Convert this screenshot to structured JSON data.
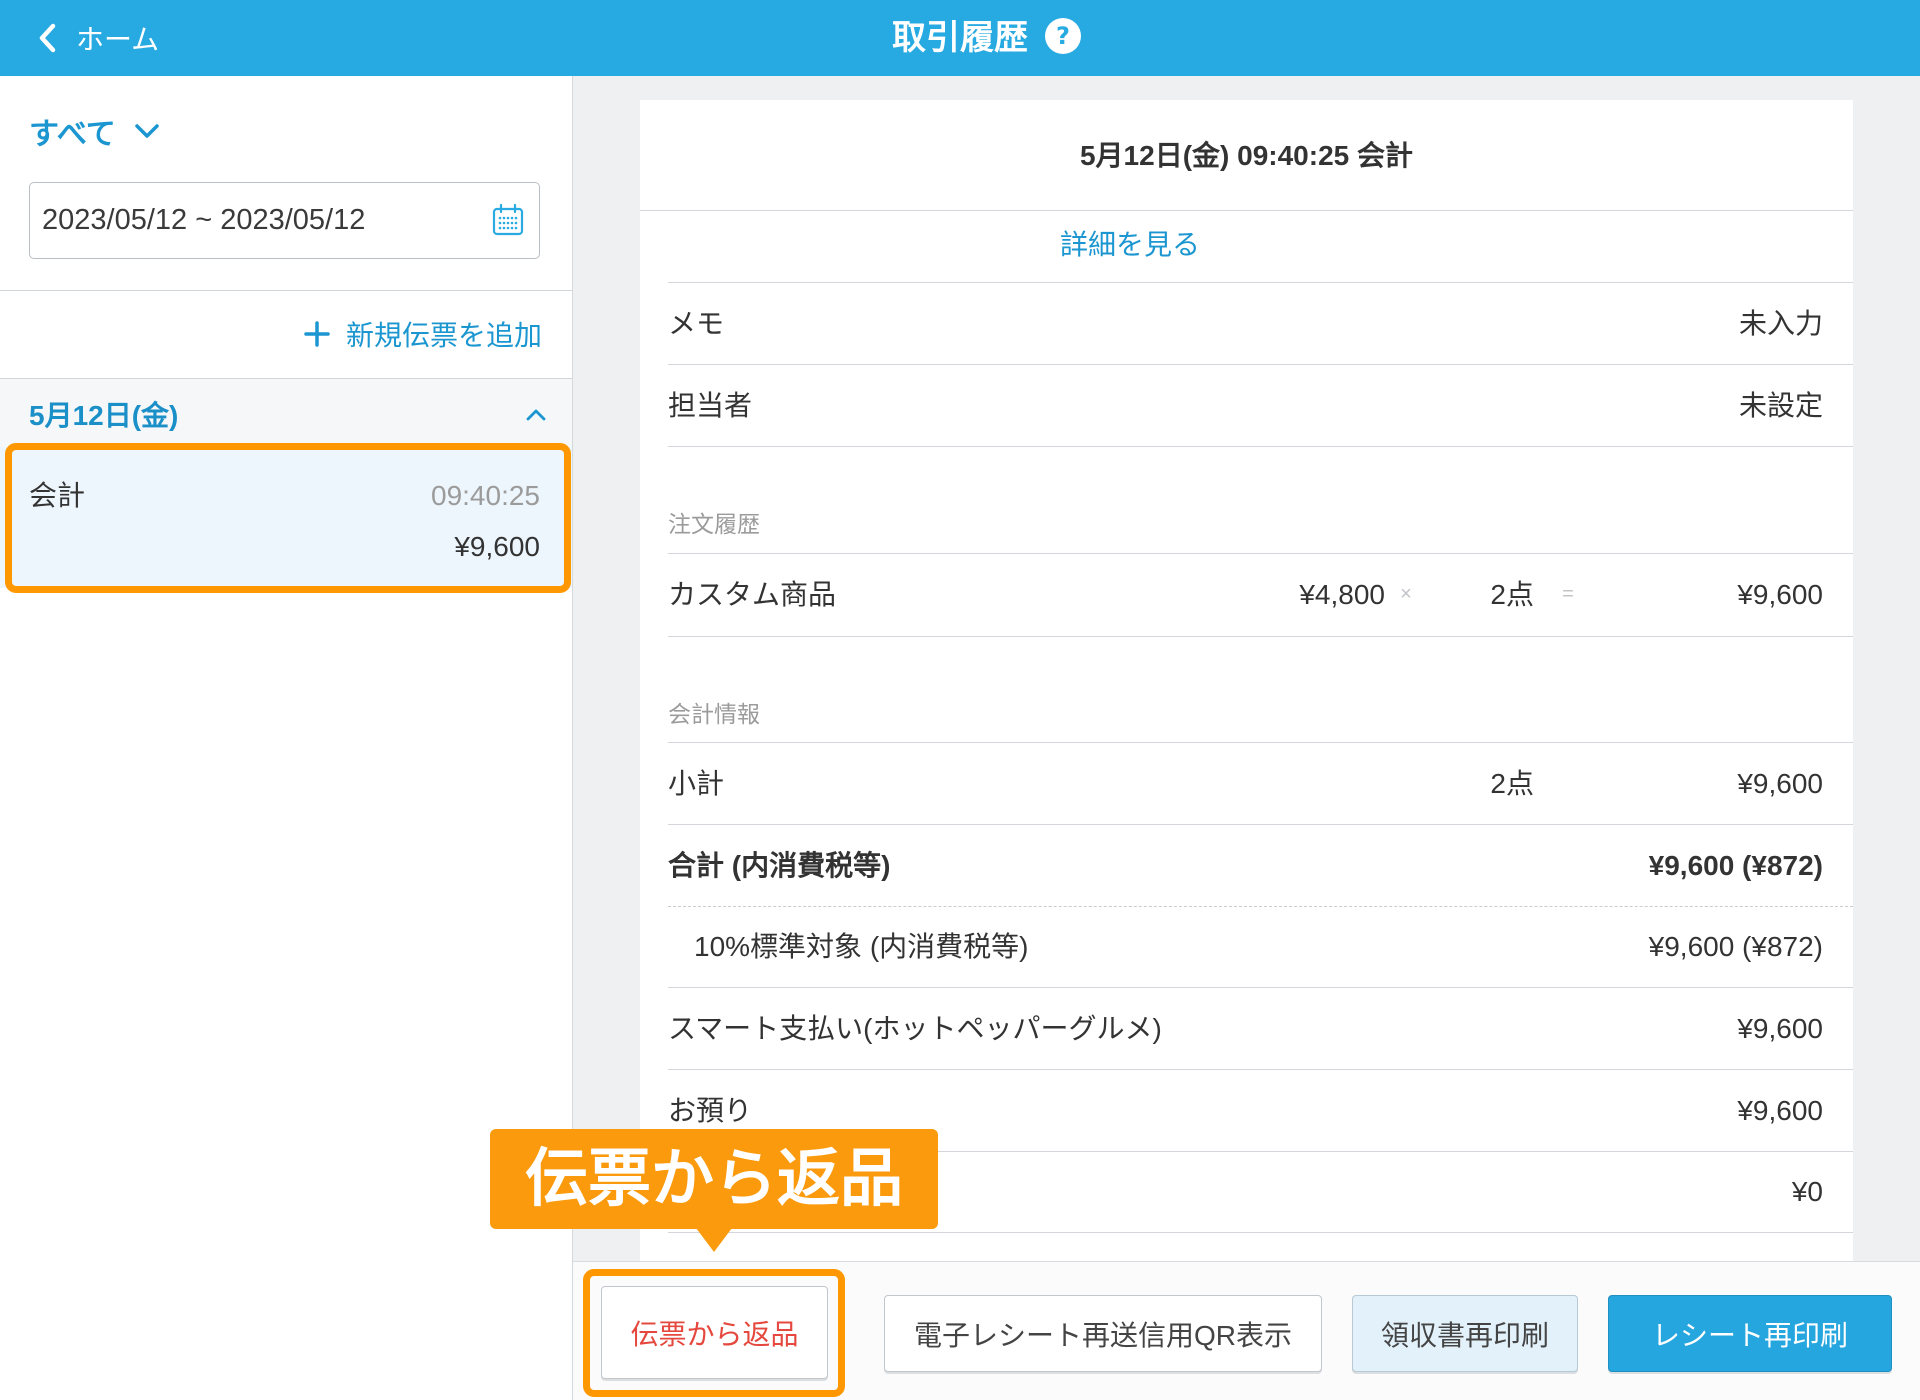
{
  "header": {
    "back_label": "ホーム",
    "title": "取引履歴",
    "back_icon": "chevron-left-icon",
    "help_icon": "help-circle-icon"
  },
  "sidebar": {
    "filter_label": "すべて",
    "filter_icon": "chevron-down-icon",
    "date_range": "2023/05/12 ~ 2023/05/12",
    "calendar_icon": "calendar-icon",
    "add_label": "新規伝票を追加",
    "add_icon": "plus-icon",
    "groups": [
      {
        "date": "5月12日(金)",
        "toggle_icon": "chevron-up-icon",
        "items": [
          {
            "type": "会計",
            "time": "09:40:25",
            "amount": "¥9,600",
            "selected": true
          }
        ]
      }
    ]
  },
  "detail": {
    "title": "5月12日(金) 09:40:25 会計",
    "details_link": "詳細を見る",
    "memo": {
      "label": "メモ",
      "value": "未入力"
    },
    "staff": {
      "label": "担当者",
      "value": "未設定"
    },
    "order_section": "注文履歴",
    "order_items": [
      {
        "name": "カスタム商品",
        "unit_price": "¥4,800",
        "times_sign": "×",
        "quantity": "2点",
        "equals_sign": "=",
        "total": "¥9,600"
      }
    ],
    "payment_section": "会計情報",
    "subtotal": {
      "label": "小計",
      "quantity": "2点",
      "value": "¥9,600"
    },
    "total": {
      "label": "合計 (内消費税等)",
      "value": "¥9,600 (¥872)"
    },
    "tax_standard_10": {
      "label": "10%標準対象 (内消費税等)",
      "value": "¥9,600 (¥872)"
    },
    "smart_payment": {
      "label": "スマート支払い(ホットペッパーグルメ)",
      "value": "¥9,600"
    },
    "deposit": {
      "label": "お預り",
      "value": "¥9,600"
    },
    "change": {
      "value": "¥0"
    }
  },
  "actions": {
    "return_label": "伝票から返品",
    "qr_label": "電子レシート再送信用QR表示",
    "receipt_label": "領収書再印刷",
    "reprint_label": "レシート再印刷"
  },
  "annotation": {
    "callout_text": "伝票から返品"
  },
  "colors": {
    "header_bg": "#27a9e1",
    "accent_text": "#1b96d0",
    "highlight": "#ff9800",
    "callout_bg": "#fa9a0c",
    "return_text": "#e4483e",
    "primary_button_bg": "#26a6df",
    "secondary_button_bg": "#e2f1fa"
  }
}
